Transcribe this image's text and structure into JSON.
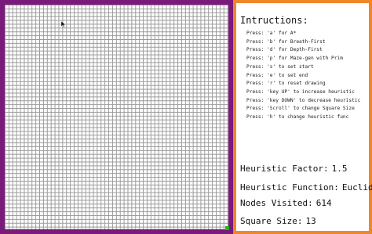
{
  "instructions": {
    "title": "Intructions:",
    "items": [
      "Press: 'a' for A*",
      "Press: 'b' for Breath-First",
      "Press: 'd' for Depth-First",
      "Press: 'p' for Maze-gen with Prim",
      "Press: 's' to set start",
      "Press: 'e' to set end",
      "Press: 'r' to reset drawing",
      "Press: 'key UP' to increase heuristic",
      "Press: 'key DOWN' to decrease heuristic",
      "Press: 'Scroll' to change Square Size",
      "Press: 'h' to change heuristic func"
    ]
  },
  "stats": {
    "heuristic_factor": {
      "label": "Heuristic Factor:",
      "value": "1.5"
    },
    "heuristic_function": {
      "label": "Heuristic Function:",
      "value": "Euclidian"
    },
    "nodes_visited": {
      "label": "Nodes Visited:",
      "value": "614"
    },
    "square_size": {
      "label": "Square Size:",
      "value": "13"
    }
  },
  "colors": {
    "grid_border": "#7a1a7a",
    "panel_border": "#f0862a",
    "end_node": "#1fb81f",
    "grid_lines": "#9a9a9a"
  },
  "icons": {
    "cursor": "mouse-pointer-icon"
  }
}
